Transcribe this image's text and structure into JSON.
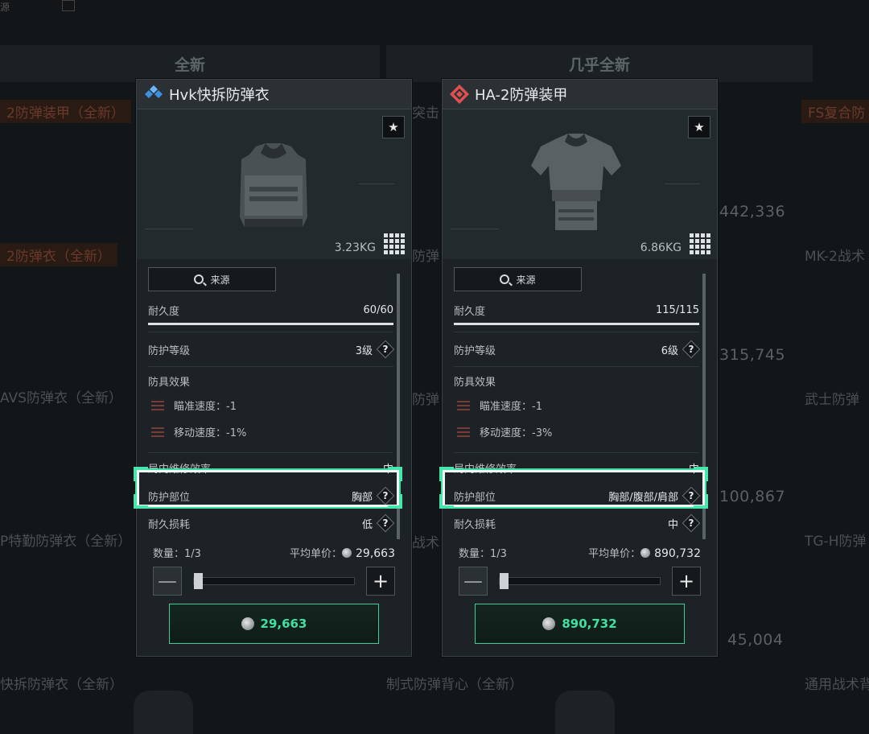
{
  "background": {
    "top_mark": "源",
    "column_headers": [
      "全新",
      "几乎全新"
    ],
    "item_names": [
      "2防弹装甲（全新）",
      "FS复合防",
      "2防弹衣（全新）",
      "MK-2战术",
      "AVS防弹衣（全新）",
      "武士防弹",
      "P特勤防弹衣（全新）",
      "TG-H防弹",
      "快拆防弹衣（全新）",
      "制式防弹背心（全新）",
      "通用战术背",
      "突击",
      "防弹",
      "防弹",
      "战术"
    ],
    "prices": [
      "442,336",
      "315,745",
      "100,867",
      "45,004"
    ]
  },
  "panels": [
    {
      "icon": "blue-diamonds-icon",
      "title": "Hvk快拆防弹衣",
      "weight": "3.23KG",
      "source_label": "来源",
      "durability_label": "耐久度",
      "durability_value": "60/60",
      "durability_fraction": 1.0,
      "protection_level_label": "防护等级",
      "protection_level_value": "3级",
      "effects_label": "防具效果",
      "effects": [
        {
          "label": "瞄准速度：-1"
        },
        {
          "label": "移动速度：-1%"
        }
      ],
      "repair_label": "局内维修效率",
      "repair_value": "中",
      "zone_label": "防护部位",
      "zone_value": "胸部",
      "wear_label": "耐久损耗",
      "wear_value": "低",
      "qty_label": "数量：1/3",
      "avg_label": "平均单价：",
      "avg_price": "29,663",
      "minus": "—",
      "plus": "+",
      "buy_price": "29,663",
      "help": "?",
      "star": "★"
    },
    {
      "icon": "red-diamond-icon",
      "title": "HA-2防弹装甲",
      "weight": "6.86KG",
      "source_label": "来源",
      "durability_label": "耐久度",
      "durability_value": "115/115",
      "durability_fraction": 1.0,
      "protection_level_label": "防护等级",
      "protection_level_value": "6级",
      "effects_label": "防具效果",
      "effects": [
        {
          "label": "瞄准速度：-1"
        },
        {
          "label": "移动速度：-3%"
        }
      ],
      "repair_label": "局内维修效率",
      "repair_value": "中",
      "zone_label": "防护部位",
      "zone_value": "胸部/腹部/肩部",
      "wear_label": "耐久损耗",
      "wear_value": "中",
      "qty_label": "数量：1/3",
      "avg_label": "平均单价：",
      "avg_price": "890,732",
      "minus": "—",
      "plus": "+",
      "buy_price": "890,732",
      "help": "?",
      "star": "★"
    }
  ],
  "colors": {
    "accent": "#3fe0a0",
    "highlight": "#48e6ac",
    "panel": "#1c2225"
  }
}
